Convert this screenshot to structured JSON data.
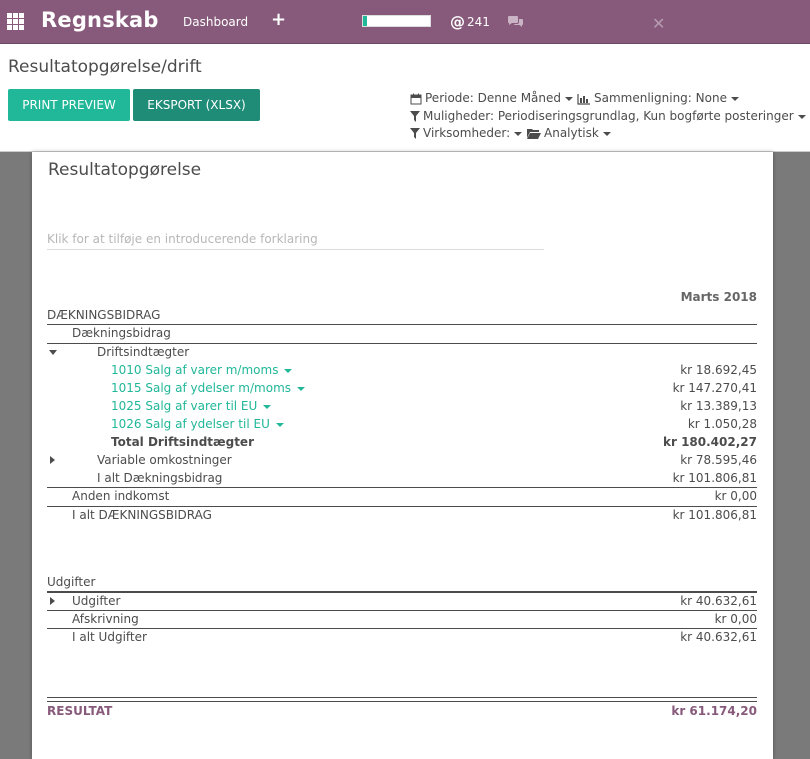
{
  "navbar": {
    "brand": "Regnskab",
    "dashboard": "Dashboard",
    "plus": "+",
    "progress_fraction": 0.06,
    "at": "@",
    "count": "241",
    "close": "✕",
    "accent": "#875a7b"
  },
  "control": {
    "breadcrumb": "Resultatopgørelse/drift",
    "print_label": "PRINT PREVIEW",
    "export_label": "EKSPORT (XLSX)",
    "periode": "Periode: Denne Måned",
    "sammenligning": "Sammenligning: None",
    "muligheder": "Muligheder: Periodiseringsgrundlag, Kun bogførte posteringer",
    "virksomheder": "Virksomheder:",
    "analytisk": "Analytisk"
  },
  "report": {
    "title": "Resultatopgørelse",
    "intro_placeholder": "Klik for at tilføje en introducerende forklaring",
    "column_header": "Marts 2018",
    "lines": [
      {
        "label": "DÆKNINGSBIDRAG",
        "value": ""
      },
      {
        "label": "Dækningsbidrag",
        "value": ""
      },
      {
        "label": "Driftsindtægter",
        "value": ""
      },
      {
        "label": "1010 Salg af varer m/moms",
        "value": "kr 18.692,45"
      },
      {
        "label": "1015 Salg af ydelser m/moms",
        "value": "kr 147.270,41"
      },
      {
        "label": "1025 Salg af varer til EU",
        "value": "kr 13.389,13"
      },
      {
        "label": "1026 Salg af ydelser til EU",
        "value": "kr 1.050,28"
      },
      {
        "label": "Total Driftsindtægter",
        "value": "kr 180.402,27"
      },
      {
        "label": "Variable omkostninger",
        "value": "kr 78.595,46"
      },
      {
        "label": "I alt Dækningsbidrag",
        "value": "kr 101.806,81"
      },
      {
        "label": "Anden indkomst",
        "value": "kr 0,00"
      },
      {
        "label": "I alt DÆKNINGSBIDRAG",
        "value": "kr 101.806,81"
      },
      {
        "label": "Udgifter",
        "value": ""
      },
      {
        "label": "Udgifter",
        "value": "kr 40.632,61"
      },
      {
        "label": "Afskrivning",
        "value": "kr 0,00"
      },
      {
        "label": "I alt Udgifter",
        "value": "kr 40.632,61"
      },
      {
        "label": "RESULTAT",
        "value": "kr 61.174,20"
      }
    ]
  }
}
